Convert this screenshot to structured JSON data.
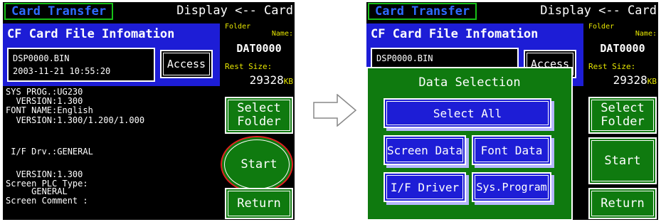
{
  "left_screen": {
    "title": "Card Transfer",
    "display_card": "Display <-- Card",
    "header": "CF Card File Infomation",
    "file_name": "DSP0000.BIN",
    "file_date": "2003-11-21 10:55:20",
    "access_label": "Access",
    "folder_label": "Folder",
    "name_label": "Name:",
    "folder_name": "DAT0000",
    "rest_size_label": "Rest Size:",
    "rest_size_value": "29328",
    "rest_size_unit": "KB",
    "info": {
      "sys_prog": "SYS PROG.:UG230",
      "sys_version": "  VERSION:1.300",
      "font_name": "FONT NAME:English",
      "font_version": "  VERSION:1.300/1.200/1.000",
      "if_drv": " I/F Drv.:GENERAL",
      "if_version": "  VERSION:1.300",
      "plc_type": "Screen PLC Type:",
      "plc_value": "     GENERAL",
      "comment": "Screen Comment :"
    },
    "select_folder_line1": "Select",
    "select_folder_line2": "Folder",
    "start_label": "Start",
    "return_label": "Return"
  },
  "right_screen": {
    "title": "Card Transfer",
    "display_card": "Display <-- Card",
    "header": "CF Card File Infomation",
    "file_name": "DSP0000.BIN",
    "access_label": "Access",
    "folder_label": "Folder",
    "name_label": "Name:",
    "folder_name": "DAT0000",
    "rest_size_label": "Rest Size:",
    "rest_size_value": "29328",
    "rest_size_unit": "KB",
    "select_folder_line1": "Select",
    "select_folder_line2": "Folder",
    "start_label": "Start",
    "return_label": "Return",
    "dialog": {
      "title": "Data Selection",
      "select_all": "Select All",
      "screen_data": "Screen Data",
      "font_data": "Font Data",
      "if_driver": "I/F Driver",
      "sys_program": "Sys.Program"
    }
  },
  "colors": {
    "title_text": "#2e6bff",
    "header_blue": "#1d1dd6",
    "button_green": "#0f7a0f",
    "label_yellow": "#e6e600",
    "highlight_circle": "#e02020"
  },
  "icons": {
    "transition_arrow": "right-arrow-icon"
  }
}
